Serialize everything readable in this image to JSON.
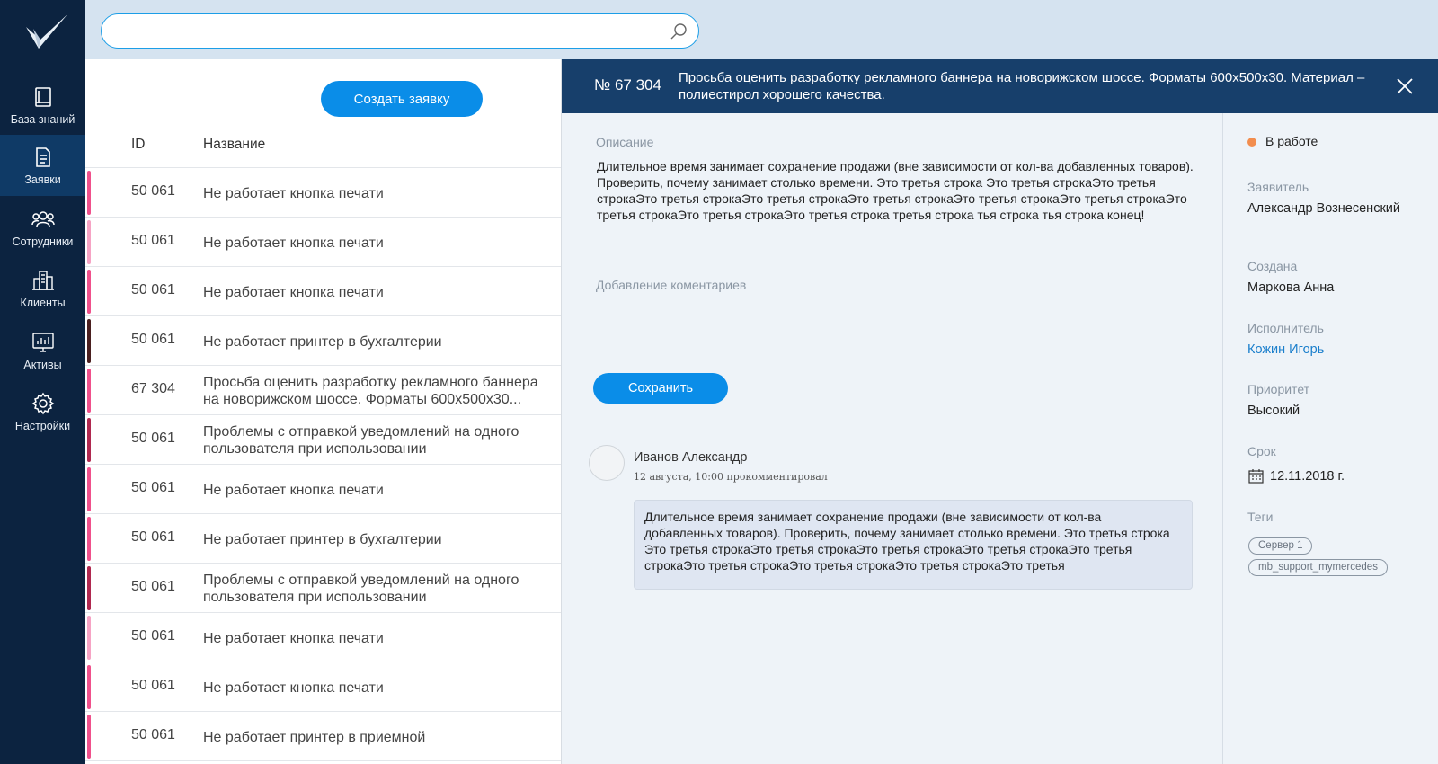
{
  "sidebar": {
    "items": [
      {
        "label": "База знаний",
        "icon": "book-icon"
      },
      {
        "label": "Заявки",
        "icon": "document-icon"
      },
      {
        "label": "Сотрудники",
        "icon": "users-icon"
      },
      {
        "label": "Клиенты",
        "icon": "buildings-icon"
      },
      {
        "label": "Активы",
        "icon": "monitor-chart-icon"
      },
      {
        "label": "Настройки",
        "icon": "gear-icon"
      }
    ],
    "active": "Заявки"
  },
  "search": {
    "value": "",
    "placeholder": ""
  },
  "list": {
    "create_button": "Создать заявку",
    "columns": {
      "id": "ID",
      "name": "Название"
    },
    "rows": [
      {
        "id": "50 061",
        "name": "Не работает кнопка печати",
        "color": "#f0508b"
      },
      {
        "id": "50 061",
        "name": "Не работает кнопка печати",
        "color": "#f6a3c4"
      },
      {
        "id": "50 061",
        "name": "Не работает кнопка печати",
        "color": "#f0508b"
      },
      {
        "id": "50 061",
        "name": "Не работает принтер в бухгалтерии",
        "color": "#4a1f1f"
      },
      {
        "id": "67 304",
        "name": "Просьба оценить разработку рекламного баннера на новорижском шоссе. Форматы 600х500х30...",
        "color": "#f0508b"
      },
      {
        "id": "50 061",
        "name": "Проблемы с отправкой уведомлений на одного пользователя при использовании",
        "color": "#b0284f"
      },
      {
        "id": "50 061",
        "name": "Не работает кнопка печати",
        "color": "#f0508b"
      },
      {
        "id": "50 061",
        "name": "Не работает принтер в бухгалтерии",
        "color": "#f0508b"
      },
      {
        "id": "50 061",
        "name": "Проблемы с отправкой уведомлений на одного пользователя при использовании",
        "color": "#b0284f"
      },
      {
        "id": "50 061",
        "name": "Не работает кнопка печати",
        "color": "#f6a3c4"
      },
      {
        "id": "50 061",
        "name": "Не работает кнопка печати",
        "color": "#f0508b"
      },
      {
        "id": "50 061",
        "name": "Не работает принтер в приемной",
        "color": "#f0508b"
      }
    ]
  },
  "detail": {
    "number": "№ 67 304",
    "title": "Просьба оценить разработку рекламного баннера на новорижском шоссе. Форматы 600х500х30. Материал – полиестирол хорошего качества.",
    "description_label": "Описание",
    "description": "Длительное время занимает сохранение продажи (вне зависимости от кол-ва добавленных товаров). Проверить, почему занимает столько времени. Это третья строка Это третья строкаЭто третья строкаЭто третья строкаЭто третья строкаЭто третья строкаЭто третья строкаЭто третья строкаЭто третья строкаЭто третья строкаЭто третья строка  третья строка  тья строка  тья строка конец!",
    "comment_label": "Добавление коментариев",
    "comment_value": "",
    "save_button": "Сохранить",
    "comment": {
      "author": "Иванов Александр",
      "meta": "12 августа, 10:00 прокомментировал",
      "text": "Длительное время занимает сохранение продажи (вне зависимости от кол-ва добавленных товаров). Проверить, почему занимает столько времени. Это третья строка Это третья строкаЭто третья строкаЭто третья строкаЭто третья строкаЭто третья строкаЭто третья строкаЭто третья строкаЭто третья строкаЭто третья"
    }
  },
  "info": {
    "status": "В работе",
    "status_color": "#f28d4e",
    "applicant_label": "Заявитель",
    "applicant": "Александр Вознесенский",
    "created_label": "Создана",
    "created": "Маркова Анна",
    "executor_label": "Исполнитель",
    "executor": "Кожин Игорь",
    "priority_label": "Приоритет",
    "priority": "Высокий",
    "deadline_label": "Срок",
    "deadline": "12.11.2018 г.",
    "tags_label": "Теги",
    "tags": [
      "Сервер 1",
      "mb_support_mymercedes"
    ]
  },
  "colors": {
    "sidebar": "#0c2340",
    "accent": "#0a8de8",
    "header": "#173f6b",
    "link": "#1b7fcc"
  }
}
